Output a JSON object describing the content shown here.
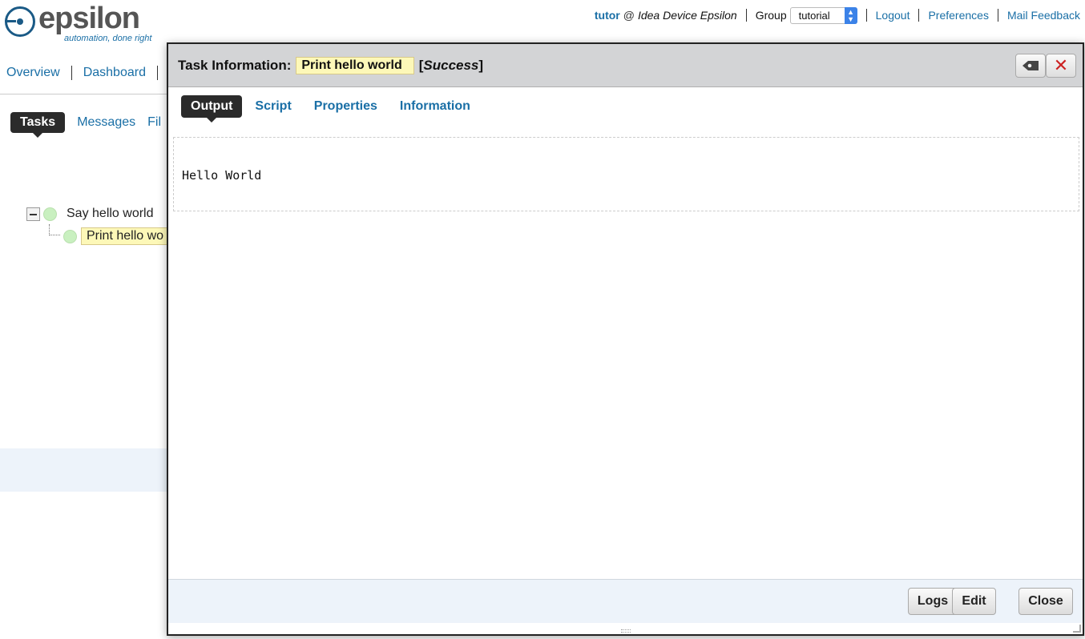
{
  "logo": {
    "word": "epsilon",
    "tagline": "automation, done",
    "tagline_em": "right"
  },
  "topbar": {
    "user": "tutor",
    "at": "@",
    "device": "Idea Device Epsilon",
    "group_label": "Group",
    "group_value": "tutorial",
    "logout": "Logout",
    "preferences": "Preferences",
    "mail_feedback": "Mail Feedback"
  },
  "mainnav": {
    "overview": "Overview",
    "dashboard": "Dashboard"
  },
  "subnav": {
    "tasks": "Tasks",
    "messages": "Messages",
    "files": "Fil"
  },
  "tree": {
    "parent": "Say hello world",
    "child": "Print hello wo"
  },
  "dialog": {
    "title": "Task Information:",
    "task_name": "Print hello world",
    "status_open": "[",
    "status": "Success",
    "status_close": "]",
    "tabs": [
      "Output",
      "Script",
      "Properties",
      "Information"
    ],
    "output": "Hello World",
    "buttons": {
      "logs": "Logs",
      "edit": "Edit",
      "close": "Close"
    }
  }
}
